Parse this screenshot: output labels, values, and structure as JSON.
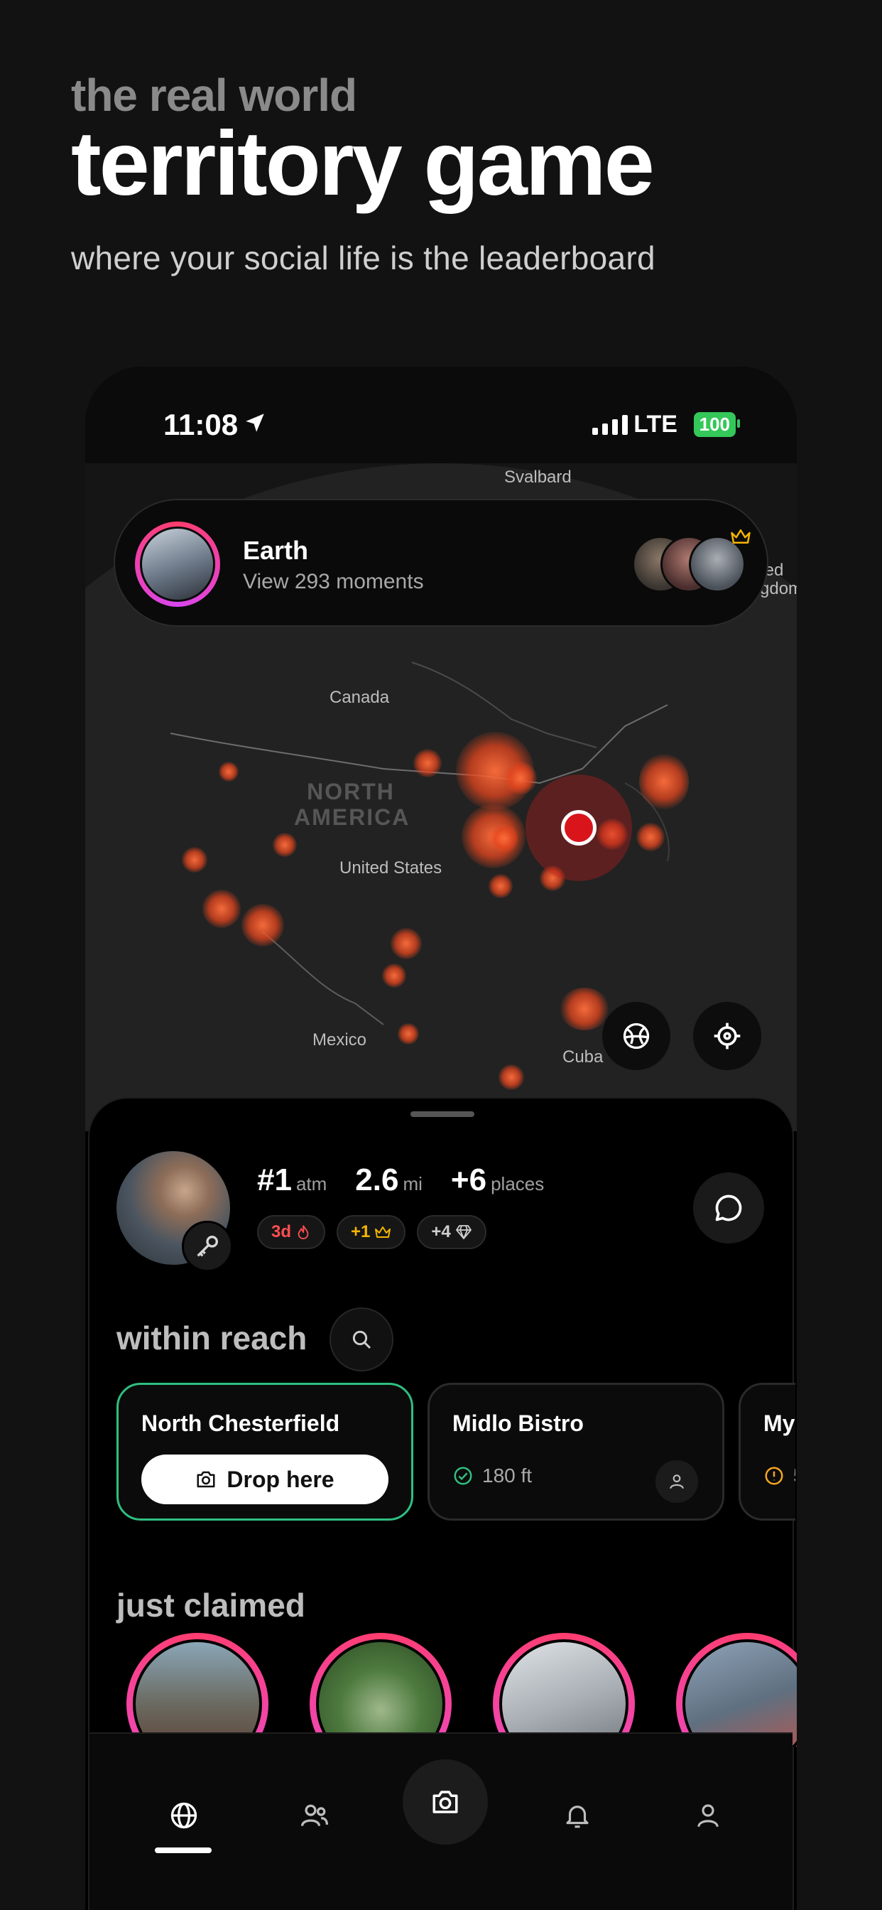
{
  "hero": {
    "kicker": "the real world",
    "headline": "territory game",
    "tagline": "where your social life is the leaderboard"
  },
  "status_bar": {
    "time": "11:08",
    "network": "LTE",
    "battery": "100"
  },
  "map": {
    "labels": {
      "svalbard": "Svalbard",
      "canada": "Canada",
      "north_america": "NORTH AMERICA",
      "united_states": "United States",
      "mexico": "Mexico",
      "cuba": "Cuba",
      "uk_partial": "ted\ngdom"
    }
  },
  "location_card": {
    "title": "Earth",
    "subtitle": "View 293 moments"
  },
  "profile": {
    "stats": [
      {
        "value": "#1",
        "unit": "atm"
      },
      {
        "value": "2.6",
        "unit": "mi"
      },
      {
        "value": "+6",
        "unit": "places"
      }
    ],
    "chips": [
      {
        "text": "3d",
        "icon": "flame-icon",
        "color": "#ff4d4f"
      },
      {
        "text": "+1",
        "icon": "crown-icon",
        "color": "#f5b400"
      },
      {
        "text": "+4",
        "icon": "diamond-icon",
        "color": "#cfcfcf"
      }
    ]
  },
  "within_reach": {
    "title": "within reach",
    "places": [
      {
        "name": "North Chesterfield",
        "action": "Drop here"
      },
      {
        "name": "Midlo Bistro",
        "distance": "180 ft"
      },
      {
        "name": "My",
        "distance": "5"
      }
    ]
  },
  "just_claimed": {
    "title": "just claimed"
  },
  "tab_bar": {
    "tabs": [
      "globe-icon",
      "friends-icon",
      "camera-icon",
      "bell-icon",
      "profile-icon"
    ],
    "active": "globe-icon"
  },
  "colors": {
    "accent_green": "#2fbf7f",
    "streak_red": "#ff4d4f",
    "crown_gold": "#f5b400",
    "ring_pink": "#ff3d6e",
    "pin_red": "#d9141b",
    "battery_green": "#34c759"
  }
}
